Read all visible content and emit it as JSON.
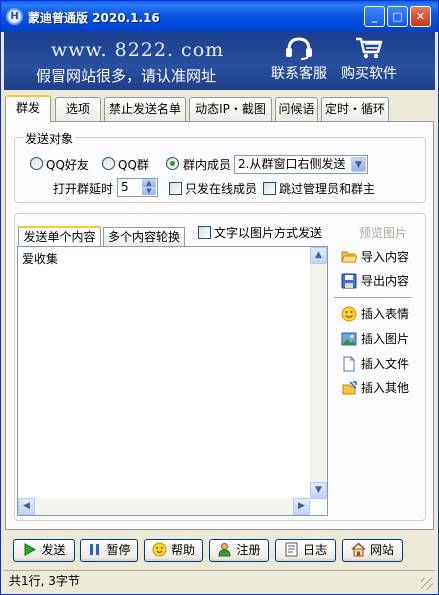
{
  "window": {
    "title": "蒙迪普通版 2020.1.16",
    "app_icon": "H",
    "controls": {
      "minimize": "_",
      "maximize": "□",
      "close": "✕"
    }
  },
  "banner": {
    "url": "www. 8222. com",
    "slogan": "假冒网站很多，请认准网址",
    "service_label": "联系客服",
    "buy_label": "购买软件"
  },
  "tabs": [
    "群发",
    "选项",
    "禁止发送名单",
    "动态IP・截图",
    "问候语",
    "定时・循环"
  ],
  "send_target": {
    "legend": "发送对象",
    "options": [
      {
        "label": "QQ好友",
        "checked": false
      },
      {
        "label": "QQ群",
        "checked": false
      },
      {
        "label": "群内成员",
        "checked": true
      }
    ],
    "mode_select": "2.从群窗口右侧发送",
    "delay_label": "打开群延时",
    "delay_value": "5",
    "online_only": "只发在线成员",
    "skip_admins": "跳过管理员和群主"
  },
  "content": {
    "subtabs": [
      "发送单个内容",
      "多个内容轮换"
    ],
    "image_mode": "文字以图片方式发送",
    "preview_label": "预览图片",
    "text": "爱收集"
  },
  "side_actions": [
    {
      "label": "导入内容",
      "icon": "folder-open-icon"
    },
    {
      "label": "导出内容",
      "icon": "save-disk-icon"
    },
    {
      "label": "插入表情",
      "icon": "smiley-icon"
    },
    {
      "label": "插入图片",
      "icon": "picture-icon"
    },
    {
      "label": "插入文件",
      "icon": "document-icon"
    },
    {
      "label": "插入其他",
      "icon": "insert-other-icon"
    }
  ],
  "bottom_buttons": [
    {
      "label": "发送",
      "icon": "play-icon"
    },
    {
      "label": "暂停",
      "icon": "pause-icon"
    },
    {
      "label": "帮助",
      "icon": "help-icon"
    },
    {
      "label": "注册",
      "icon": "user-icon"
    },
    {
      "label": "日志",
      "icon": "log-icon"
    },
    {
      "label": "网站",
      "icon": "home-icon"
    }
  ],
  "status": "共1行, 3字节",
  "colors": {
    "title_bar": "#0a56e0",
    "banner_bg": "#28509f",
    "window_bg": "#ece9d8",
    "active_tab_accent": "#ffc83c"
  }
}
